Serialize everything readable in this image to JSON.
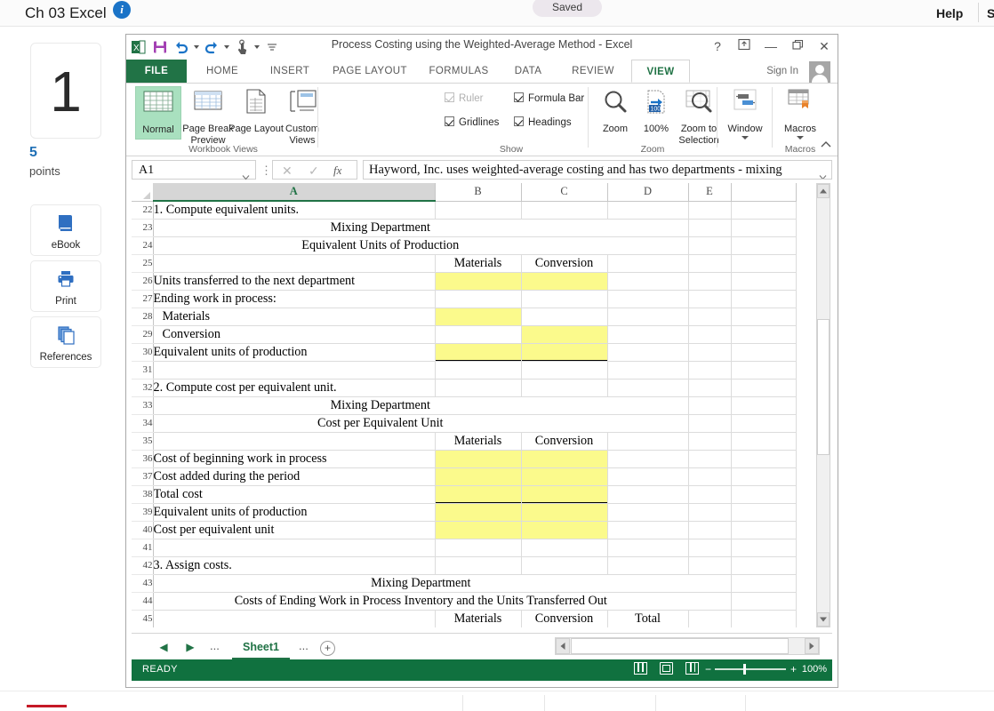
{
  "lms": {
    "title": "Ch 03 Excel",
    "info_icon": "info-icon",
    "saved_label": "Saved",
    "help_label": "Help",
    "help_label_2": "S",
    "question_number": "1",
    "points_value": "5",
    "points_label": "points",
    "rail_buttons": [
      {
        "label": "eBook",
        "icon": "book-icon"
      },
      {
        "label": "Print",
        "icon": "printer-icon"
      },
      {
        "label": "References",
        "icon": "copy-pages-icon"
      }
    ]
  },
  "excel": {
    "window_title": "Process Costing using the Weighted-Average Method - Excel",
    "quick_access": [
      {
        "name": "excel-logo-icon"
      },
      {
        "name": "save-icon"
      },
      {
        "name": "undo-icon"
      },
      {
        "name": "redo-icon"
      },
      {
        "name": "touch-mode-icon"
      },
      {
        "name": "customize-qat-icon"
      }
    ],
    "window_buttons": {
      "help": "?",
      "ribbon_display": "ribbon-display-icon",
      "minimize": "—",
      "restore": "restore-icon",
      "close": "✕"
    },
    "tabs": [
      {
        "label": "FILE",
        "active": false
      },
      {
        "label": "HOME",
        "active": false
      },
      {
        "label": "INSERT",
        "active": false
      },
      {
        "label": "PAGE LAYOUT",
        "active": false
      },
      {
        "label": "FORMULAS",
        "active": false
      },
      {
        "label": "DATA",
        "active": false
      },
      {
        "label": "REVIEW",
        "active": false
      },
      {
        "label": "VIEW",
        "active": true
      }
    ],
    "sign_in": "Sign In",
    "ribbon": {
      "groups": [
        {
          "name": "Workbook Views"
        },
        {
          "name": "Show"
        },
        {
          "name": "Zoom"
        },
        {
          "name": "Macros"
        }
      ],
      "workbook_views": [
        {
          "label": "Normal",
          "icon": "normal-view-icon",
          "selected": true
        },
        {
          "label": "Page Break Preview",
          "icon": "page-break-preview-icon",
          "selected": false
        },
        {
          "label": "Page Layout",
          "icon": "page-layout-icon",
          "selected": false
        },
        {
          "label": "Custom Views",
          "icon": "custom-views-icon",
          "selected": false
        }
      ],
      "show_checkboxes": [
        {
          "label": "Ruler",
          "checked": true,
          "disabled": true
        },
        {
          "label": "Formula Bar",
          "checked": true,
          "disabled": false
        },
        {
          "label": "Gridlines",
          "checked": true,
          "disabled": false
        },
        {
          "label": "Headings",
          "checked": true,
          "disabled": false
        }
      ],
      "zoom_buttons": [
        {
          "label": "Zoom",
          "icon": "magnifier-icon"
        },
        {
          "label": "100%",
          "icon": "zoom-100-icon"
        },
        {
          "label": "Zoom to Selection",
          "icon": "zoom-to-selection-icon"
        }
      ],
      "window_buttons": [
        {
          "label": "Window",
          "icon": "switch-windows-icon"
        }
      ],
      "macros_buttons": [
        {
          "label": "Macros",
          "icon": "macros-icon"
        }
      ],
      "collapse_icon": "chevron-up-icon"
    },
    "formula_bar": {
      "name_box_value": "A1",
      "cancel_icon": "✕",
      "enter_icon": "✓",
      "function_icon": "fx",
      "content": "Hayword, Inc. uses weighted-average costing and has two departments - mixing"
    },
    "grid": {
      "columns": [
        "A",
        "B",
        "C",
        "D",
        "E",
        ""
      ],
      "selected_column": "A",
      "rows": [
        {
          "n": "22",
          "cells": [
            {
              "t": "1. Compute equivalent units.",
              "a": "left"
            },
            {
              "t": "",
              "a": "left"
            },
            {
              "t": "",
              "a": "left"
            },
            {
              "t": "",
              "a": "left"
            },
            {
              "t": "",
              "a": "left"
            },
            {
              "t": "",
              "a": "left"
            }
          ]
        },
        {
          "n": "23",
          "cells": [
            {
              "t": "Mixing Department",
              "a": "span-center",
              "span": 3
            },
            {
              "t": "",
              "a": "left"
            },
            {
              "t": "",
              "a": "left"
            },
            {
              "t": "",
              "a": "left"
            }
          ]
        },
        {
          "n": "24",
          "cells": [
            {
              "t": "Equivalent Units of Production",
              "a": "span-center",
              "span": 3
            },
            {
              "t": "",
              "a": "left"
            },
            {
              "t": "",
              "a": "left"
            },
            {
              "t": "",
              "a": "left"
            }
          ]
        },
        {
          "n": "25",
          "cells": [
            {
              "t": "",
              "a": "left"
            },
            {
              "t": "Materials",
              "a": "center"
            },
            {
              "t": "Conversion",
              "a": "center"
            },
            {
              "t": "",
              "a": "left"
            },
            {
              "t": "",
              "a": "left"
            },
            {
              "t": "",
              "a": "left"
            }
          ]
        },
        {
          "n": "26",
          "cells": [
            {
              "t": "Units transferred to the next department",
              "a": "left"
            },
            {
              "t": "",
              "a": "center",
              "yellow": true
            },
            {
              "t": "",
              "a": "center",
              "yellow": true
            },
            {
              "t": "",
              "a": "left"
            },
            {
              "t": "",
              "a": "left"
            },
            {
              "t": "",
              "a": "left"
            }
          ]
        },
        {
          "n": "27",
          "cells": [
            {
              "t": "Ending work in process:",
              "a": "left"
            },
            {
              "t": "",
              "a": "left"
            },
            {
              "t": "",
              "a": "left"
            },
            {
              "t": "",
              "a": "left"
            },
            {
              "t": "",
              "a": "left"
            },
            {
              "t": "",
              "a": "left"
            }
          ]
        },
        {
          "n": "28",
          "cells": [
            {
              "t": "Materials",
              "a": "indent"
            },
            {
              "t": "",
              "a": "center",
              "yellow": true
            },
            {
              "t": "",
              "a": "left"
            },
            {
              "t": "",
              "a": "left"
            },
            {
              "t": "",
              "a": "left"
            },
            {
              "t": "",
              "a": "left"
            }
          ]
        },
        {
          "n": "29",
          "cells": [
            {
              "t": "Conversion",
              "a": "indent"
            },
            {
              "t": "",
              "a": "left"
            },
            {
              "t": "",
              "a": "center",
              "yellow": true
            },
            {
              "t": "",
              "a": "left"
            },
            {
              "t": "",
              "a": "left"
            },
            {
              "t": "",
              "a": "left"
            }
          ]
        },
        {
          "n": "30",
          "cells": [
            {
              "t": "Equivalent units of production",
              "a": "left"
            },
            {
              "t": "",
              "a": "center",
              "yellow": true,
              "topline": true,
              "botline": true
            },
            {
              "t": "",
              "a": "center",
              "yellow": true,
              "topline": true,
              "botline": true
            },
            {
              "t": "",
              "a": "left"
            },
            {
              "t": "",
              "a": "left"
            },
            {
              "t": "",
              "a": "left"
            }
          ]
        },
        {
          "n": "31",
          "cells": [
            {
              "t": "",
              "a": "left"
            },
            {
              "t": "",
              "a": "left"
            },
            {
              "t": "",
              "a": "left"
            },
            {
              "t": "",
              "a": "left"
            },
            {
              "t": "",
              "a": "left"
            },
            {
              "t": "",
              "a": "left"
            }
          ]
        },
        {
          "n": "32",
          "cells": [
            {
              "t": "2. Compute cost per equivalent unit.",
              "a": "left"
            },
            {
              "t": "",
              "a": "left"
            },
            {
              "t": "",
              "a": "left"
            },
            {
              "t": "",
              "a": "left"
            },
            {
              "t": "",
              "a": "left"
            },
            {
              "t": "",
              "a": "left"
            }
          ]
        },
        {
          "n": "33",
          "cells": [
            {
              "t": "Mixing Department",
              "a": "span-center",
              "span": 3
            },
            {
              "t": "",
              "a": "left"
            },
            {
              "t": "",
              "a": "left"
            },
            {
              "t": "",
              "a": "left"
            }
          ]
        },
        {
          "n": "34",
          "cells": [
            {
              "t": "Cost per Equivalent Unit",
              "a": "span-center",
              "span": 3
            },
            {
              "t": "",
              "a": "left"
            },
            {
              "t": "",
              "a": "left"
            },
            {
              "t": "",
              "a": "left"
            }
          ]
        },
        {
          "n": "35",
          "cells": [
            {
              "t": "",
              "a": "left"
            },
            {
              "t": "Materials",
              "a": "center"
            },
            {
              "t": "Conversion",
              "a": "center"
            },
            {
              "t": "",
              "a": "left"
            },
            {
              "t": "",
              "a": "left"
            },
            {
              "t": "",
              "a": "left"
            }
          ]
        },
        {
          "n": "36",
          "cells": [
            {
              "t": "Cost of beginning work in process",
              "a": "left"
            },
            {
              "t": "",
              "a": "center",
              "yellow": true
            },
            {
              "t": "",
              "a": "center",
              "yellow": true
            },
            {
              "t": "",
              "a": "left"
            },
            {
              "t": "",
              "a": "left"
            },
            {
              "t": "",
              "a": "left"
            }
          ]
        },
        {
          "n": "37",
          "cells": [
            {
              "t": "Cost added during the period",
              "a": "left"
            },
            {
              "t": "",
              "a": "center",
              "yellow": true
            },
            {
              "t": "",
              "a": "center",
              "yellow": true
            },
            {
              "t": "",
              "a": "left"
            },
            {
              "t": "",
              "a": "left"
            },
            {
              "t": "",
              "a": "left"
            }
          ]
        },
        {
          "n": "38",
          "cells": [
            {
              "t": "Total cost",
              "a": "left"
            },
            {
              "t": "",
              "a": "center",
              "yellow": true,
              "topline": true,
              "botline": true
            },
            {
              "t": "",
              "a": "center",
              "yellow": true,
              "topline": true,
              "botline": true
            },
            {
              "t": "",
              "a": "left"
            },
            {
              "t": "",
              "a": "left"
            },
            {
              "t": "",
              "a": "left"
            }
          ]
        },
        {
          "n": "39",
          "cells": [
            {
              "t": "Equivalent units of production",
              "a": "left"
            },
            {
              "t": "",
              "a": "center",
              "yellow": true
            },
            {
              "t": "",
              "a": "center",
              "yellow": true
            },
            {
              "t": "",
              "a": "left"
            },
            {
              "t": "",
              "a": "left"
            },
            {
              "t": "",
              "a": "left"
            }
          ]
        },
        {
          "n": "40",
          "cells": [
            {
              "t": "Cost per equivalent unit",
              "a": "left"
            },
            {
              "t": "",
              "a": "center",
              "yellow": true
            },
            {
              "t": "",
              "a": "center",
              "yellow": true
            },
            {
              "t": "",
              "a": "left"
            },
            {
              "t": "",
              "a": "left"
            },
            {
              "t": "",
              "a": "left"
            }
          ]
        },
        {
          "n": "41",
          "cells": [
            {
              "t": "",
              "a": "left"
            },
            {
              "t": "",
              "a": "left"
            },
            {
              "t": "",
              "a": "left"
            },
            {
              "t": "",
              "a": "left"
            },
            {
              "t": "",
              "a": "left"
            },
            {
              "t": "",
              "a": "left"
            }
          ]
        },
        {
          "n": "42",
          "cells": [
            {
              "t": "3. Assign costs.",
              "a": "left"
            },
            {
              "t": "",
              "a": "left"
            },
            {
              "t": "",
              "a": "left"
            },
            {
              "t": "",
              "a": "left"
            },
            {
              "t": "",
              "a": "left"
            },
            {
              "t": "",
              "a": "left"
            }
          ]
        },
        {
          "n": "43",
          "cells": [
            {
              "t": "Mixing Department",
              "a": "span-center",
              "span": 4
            },
            {
              "t": "",
              "a": "left"
            },
            {
              "t": "",
              "a": "left"
            }
          ]
        },
        {
          "n": "44",
          "cells": [
            {
              "t": "Costs of Ending Work in Process Inventory and the Units Transferred Out",
              "a": "span-center",
              "span": 4
            },
            {
              "t": "",
              "a": "left"
            },
            {
              "t": "",
              "a": "left"
            }
          ]
        },
        {
          "n": "45",
          "cells": [
            {
              "t": "",
              "a": "left"
            },
            {
              "t": "Materials",
              "a": "center"
            },
            {
              "t": "Conversion",
              "a": "center"
            },
            {
              "t": "Total",
              "a": "center"
            },
            {
              "t": "",
              "a": "left"
            },
            {
              "t": "",
              "a": "left"
            }
          ]
        }
      ]
    },
    "sheet_tabs": {
      "first_icon": "first-sheet-icon",
      "prev_icon": "prev-sheet-icon",
      "left_dots": "...",
      "active_sheet": "Sheet1",
      "right_dots": "...",
      "add_icon": "+"
    },
    "status_bar": {
      "ready": "READY",
      "views": [
        "normal-view-icon",
        "page-layout-view-icon",
        "page-break-view-icon"
      ],
      "zoom_out": "−",
      "zoom_in": "+",
      "zoom_level": "100%"
    }
  }
}
